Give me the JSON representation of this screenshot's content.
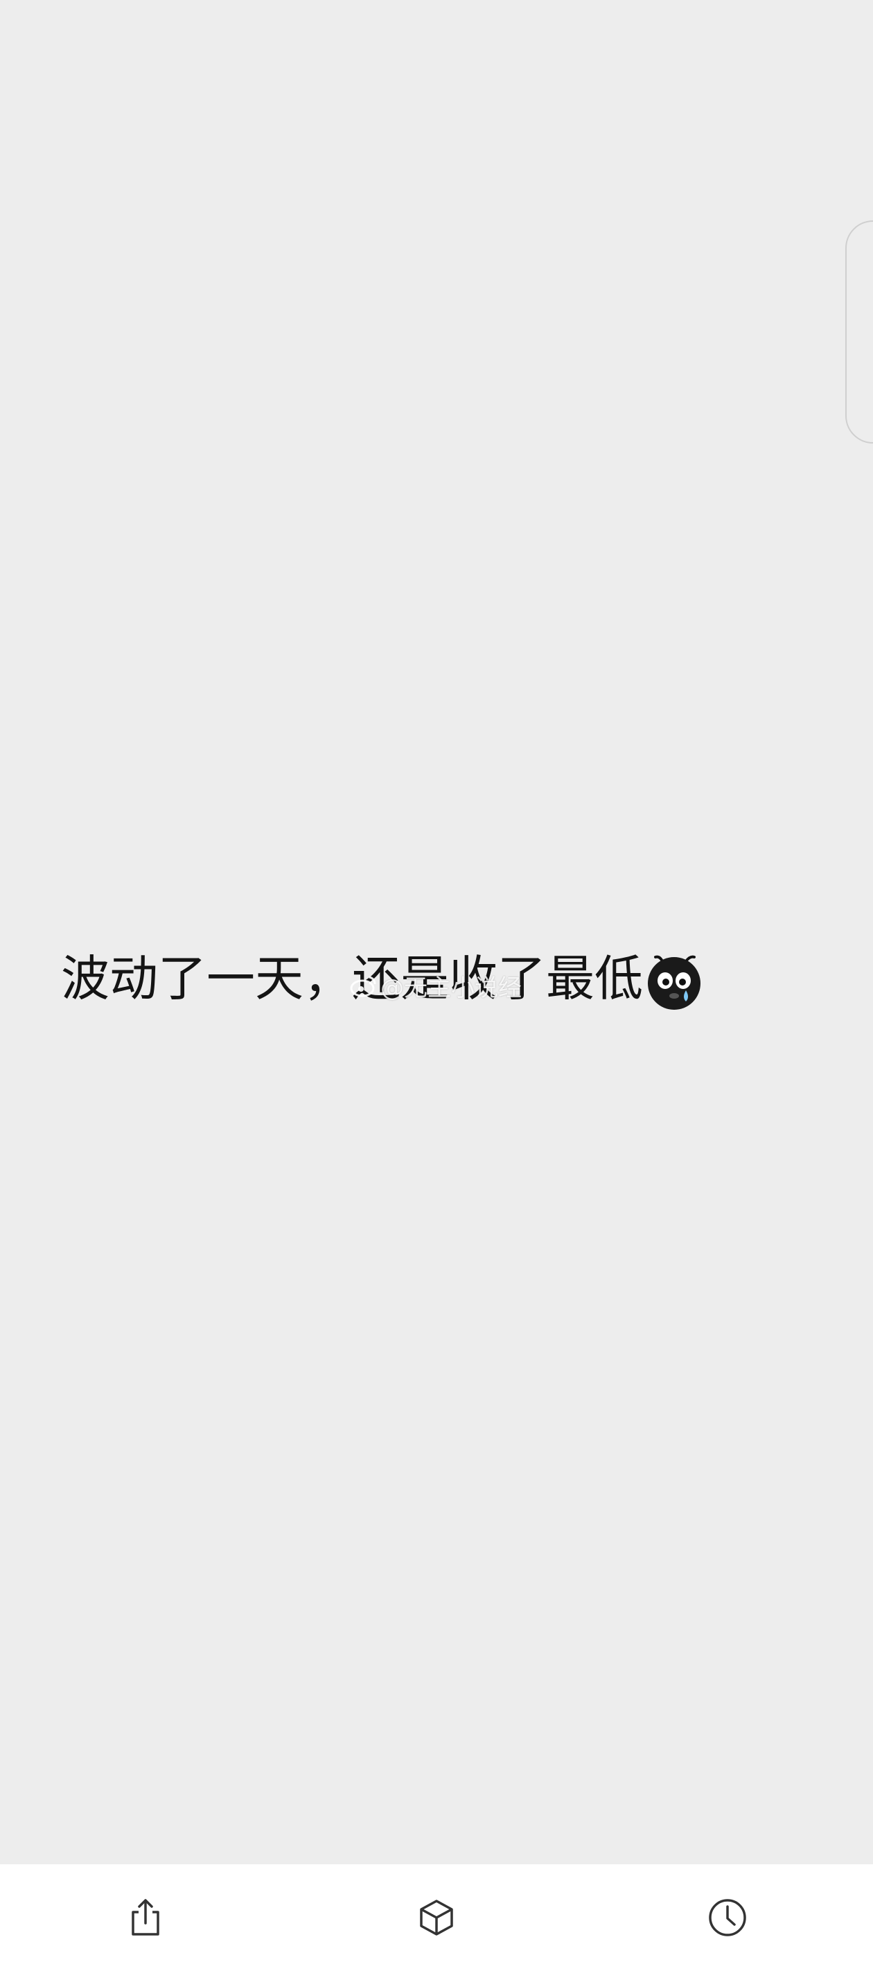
{
  "post": {
    "text": "波动了一天，还是收了最低",
    "emoji": "crying-face-emoji"
  },
  "watermark": {
    "text": "@无主小说经"
  },
  "bottom_bar": {
    "buttons": [
      {
        "icon": "share-icon"
      },
      {
        "icon": "cube-icon"
      },
      {
        "icon": "clock-icon"
      }
    ]
  },
  "colors": {
    "background": "#ededed",
    "bar_background": "#ffffff",
    "text": "#141414",
    "icon": "#333333"
  }
}
